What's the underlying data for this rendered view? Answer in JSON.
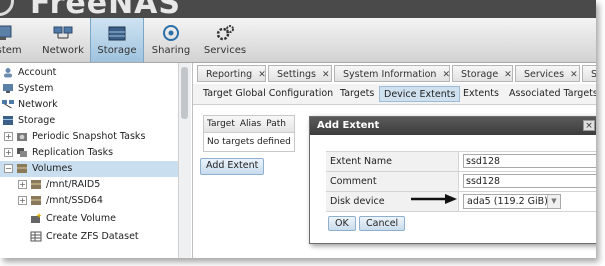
{
  "brand": {
    "name": "FreeNAS"
  },
  "toolbar": {
    "items": [
      {
        "label": "System",
        "icon": "system-icon"
      },
      {
        "label": "Network",
        "icon": "network-icon"
      },
      {
        "label": "Storage",
        "icon": "storage-icon",
        "active": true
      },
      {
        "label": "Sharing",
        "icon": "sharing-icon"
      },
      {
        "label": "Services",
        "icon": "services-icon"
      }
    ]
  },
  "tree": {
    "items": [
      {
        "label": "Account"
      },
      {
        "label": "System"
      },
      {
        "label": "Network"
      },
      {
        "label": "Storage"
      },
      {
        "label": "Periodic Snapshot Tasks"
      },
      {
        "label": "Replication Tasks"
      },
      {
        "label": "Volumes"
      },
      {
        "label": "/mnt/RAID5"
      },
      {
        "label": "/mnt/SSD64"
      },
      {
        "label": "Create Volume"
      },
      {
        "label": "Create ZFS Dataset"
      }
    ]
  },
  "tabs": [
    {
      "label": "Reporting"
    },
    {
      "label": "Settings"
    },
    {
      "label": "System Information"
    },
    {
      "label": "Storage"
    },
    {
      "label": "Services"
    },
    {
      "label": "S"
    }
  ],
  "subnav": {
    "items": [
      {
        "label": "Target Global Configuration"
      },
      {
        "label": "Targets"
      },
      {
        "label": "Device Extents",
        "active": true
      },
      {
        "label": "Extents"
      },
      {
        "label": "Associated Targets"
      }
    ]
  },
  "targets_table": {
    "columns": [
      "Target",
      "Alias",
      "Path"
    ],
    "empty_text": "No targets defined"
  },
  "add_extent_button": "Add Extent",
  "dialog": {
    "title": "Add Extent",
    "close_label": "×",
    "fields": {
      "extent_name": {
        "label": "Extent Name",
        "value": "ssd128"
      },
      "comment": {
        "label": "Comment",
        "value": "ssd128"
      },
      "disk_device": {
        "label": "Disk device",
        "value": "ada5 (119.2 GiB)"
      }
    },
    "ok_label": "OK",
    "cancel_label": "Cancel"
  },
  "colors": {
    "brand_bar": "#4a4a4a",
    "active_toolbar": "#9fc3de",
    "dialog_title": "#3c3c3c",
    "selection": "#c9dff0"
  }
}
